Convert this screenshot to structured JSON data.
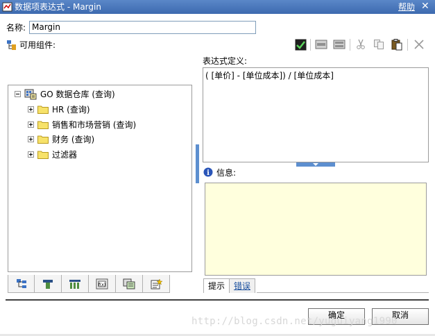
{
  "window": {
    "title": "数据项表达式 - Margin",
    "help_label": "帮助",
    "close_glyph": "✕"
  },
  "name_field": {
    "label": "名称:",
    "value": "Margin"
  },
  "available_components": {
    "label": "可用组件:"
  },
  "toolbar": {
    "icons": [
      "validate-check-icon",
      "insert-row-icon",
      "insert-row-alt-icon",
      "cut-icon",
      "copy-icon",
      "paste-icon",
      "delete-icon"
    ],
    "check_color": "#2f8a2f"
  },
  "tree": {
    "root": {
      "label": "GO 数据仓库 (查询)"
    },
    "children": [
      {
        "label": "HR (查询)"
      },
      {
        "label": "销售和市场营销 (查询)"
      },
      {
        "label": "财务 (查询)"
      },
      {
        "label": "过滤器"
      }
    ]
  },
  "expression": {
    "label": "表达式定义:",
    "value": "( [单价] - [单位成本]) / [单位成本]"
  },
  "info": {
    "label": "信息:"
  },
  "bottom_tabs": [
    {
      "label": "提示"
    },
    {
      "label": "错误"
    }
  ],
  "buttons": {
    "ok": "确定",
    "cancel": "取消"
  },
  "watermark": "http://blog.csdn.net/yuguiyang1990"
}
